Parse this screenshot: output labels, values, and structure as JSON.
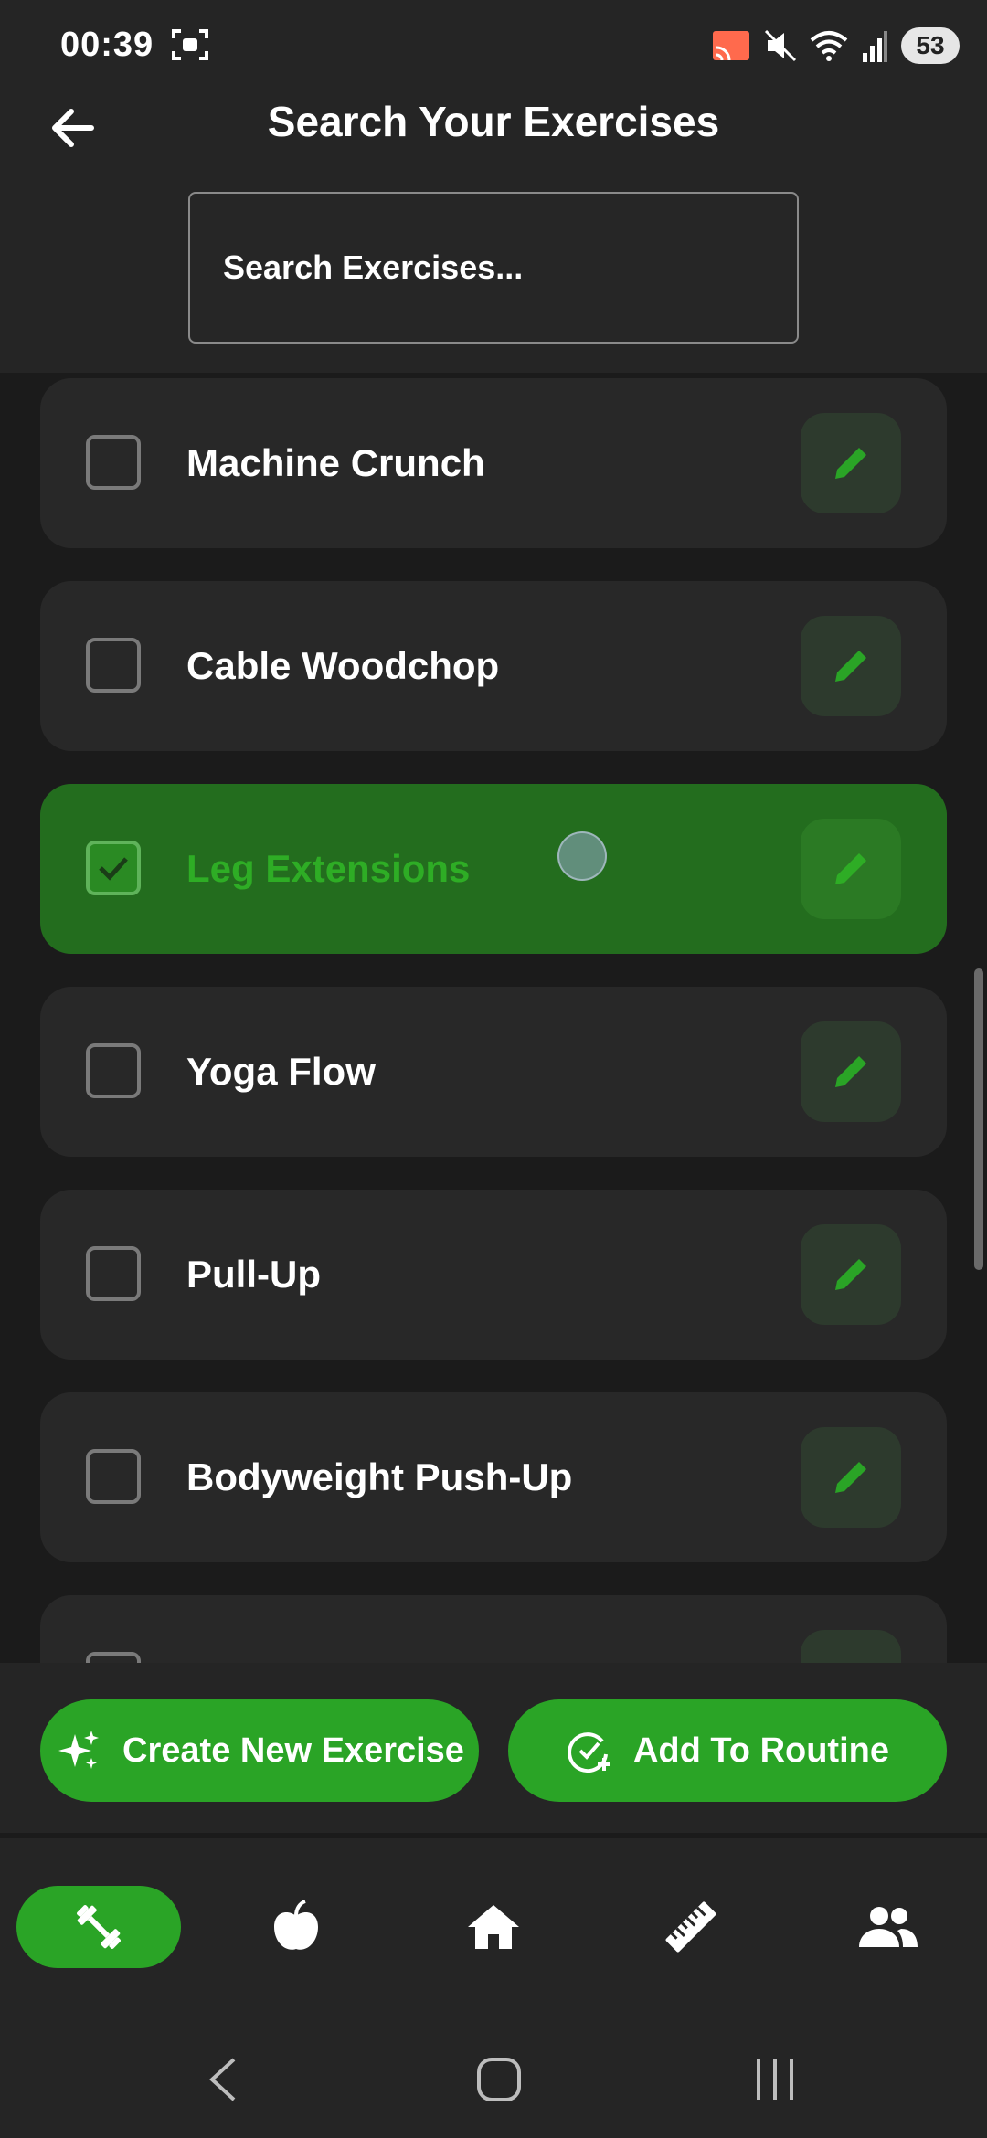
{
  "status_bar": {
    "time": "00:39",
    "battery": "53"
  },
  "header": {
    "title": "Search Your Exercises"
  },
  "search": {
    "placeholder": "Search Exercises..."
  },
  "exercises": [
    {
      "name": "Machine Crunch",
      "checked": false
    },
    {
      "name": "Cable Woodchop",
      "checked": false
    },
    {
      "name": "Leg Extensions",
      "checked": true
    },
    {
      "name": "Yoga Flow",
      "checked": false
    },
    {
      "name": "Pull-Up",
      "checked": false
    },
    {
      "name": "Bodyweight Push-Up",
      "checked": false
    }
  ],
  "actions": {
    "create_label": "Create New Exercise",
    "routine_label": "Add To Routine"
  },
  "bottom_nav": [
    {
      "icon": "dumbbell-icon",
      "active": true
    },
    {
      "icon": "apple-icon",
      "active": false
    },
    {
      "icon": "home-icon",
      "active": false
    },
    {
      "icon": "ruler-icon",
      "active": false
    },
    {
      "icon": "people-icon",
      "active": false
    }
  ],
  "colors": {
    "accent": "#2aa426",
    "selected_card": "#236d1e",
    "background": "#1b1b1b",
    "card": "#282828"
  }
}
